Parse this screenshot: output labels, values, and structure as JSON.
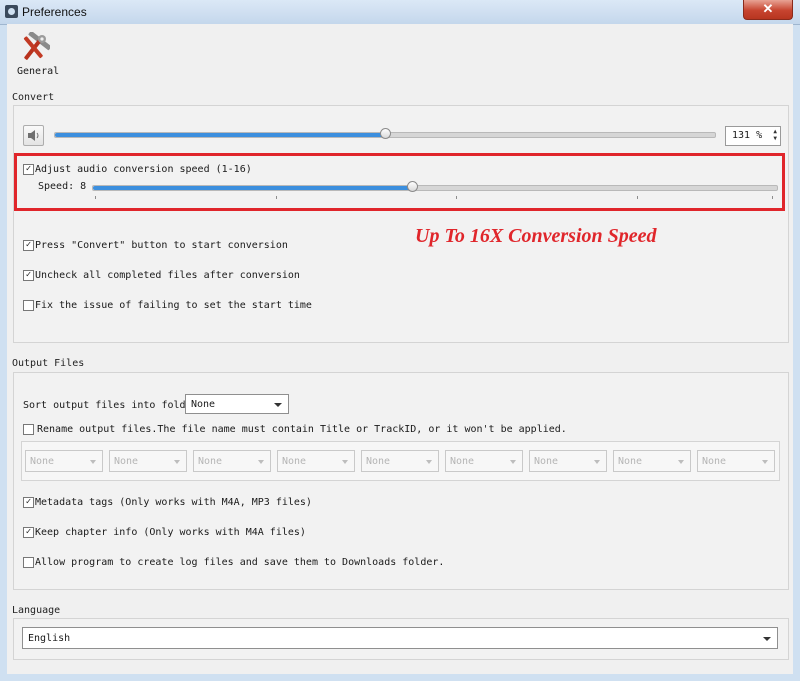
{
  "window": {
    "title": "Preferences",
    "close_glyph": "✕"
  },
  "toolbar": {
    "general_label": "General",
    "general_icon": "tools-icon"
  },
  "convert": {
    "section_title": "Convert",
    "volume_icon": "speaker-icon",
    "volume_level_fraction": 0.5,
    "volume_value": "131 %",
    "adjust_speed": {
      "checked": true,
      "label": "Adjust audio conversion speed (1-16)"
    },
    "speed_label": "Speed: 8",
    "speed_value": 8,
    "speed_min": 1,
    "speed_max": 16,
    "promo_text": "Up To 16X Conversion Speed",
    "options": [
      {
        "checked": true,
        "label": "Press \"Convert\" button to start conversion"
      },
      {
        "checked": true,
        "label": "Uncheck all completed files after conversion"
      },
      {
        "checked": false,
        "label": "Fix the issue of failing to set the start time"
      }
    ]
  },
  "output": {
    "section_title": "Output Files",
    "sort_label": "Sort output files into folders by:",
    "sort_value": "None",
    "rename": {
      "checked": false,
      "label": "Rename output files.The file name must contain Title or TrackID, or it won't be applied."
    },
    "rename_fields": [
      "None",
      "None",
      "None",
      "None",
      "None",
      "None",
      "None",
      "None",
      "None"
    ],
    "options": [
      {
        "checked": true,
        "label": "Metadata tags (Only works with M4A, MP3 files)"
      },
      {
        "checked": true,
        "label": "Keep chapter info (Only works with M4A files)"
      },
      {
        "checked": false,
        "label": "Allow program to create log files and save them to Downloads folder."
      }
    ]
  },
  "language": {
    "section_title": "Language",
    "value": "English"
  },
  "colors": {
    "accent": "#3c8fde",
    "highlight": "#e0262b"
  }
}
